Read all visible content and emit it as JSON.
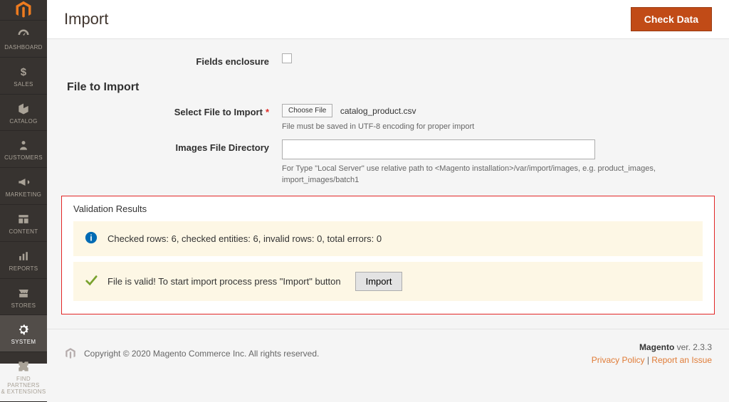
{
  "header": {
    "title": "Import",
    "check_data_label": "Check Data"
  },
  "sidebar": {
    "items": [
      {
        "label": "DASHBOARD"
      },
      {
        "label": "SALES"
      },
      {
        "label": "CATALOG"
      },
      {
        "label": "CUSTOMERS"
      },
      {
        "label": "MARKETING"
      },
      {
        "label": "CONTENT"
      },
      {
        "label": "REPORTS"
      },
      {
        "label": "STORES"
      },
      {
        "label": "SYSTEM"
      },
      {
        "label": "FIND PARTNERS\n& EXTENSIONS"
      }
    ]
  },
  "form": {
    "fields_enclosure_label": "Fields enclosure",
    "section_title": "File to Import",
    "select_file_label": "Select File to Import",
    "choose_file_button": "Choose File",
    "selected_file_name": "catalog_product.csv",
    "select_file_hint": "File must be saved in UTF-8 encoding for proper import",
    "images_dir_label": "Images File Directory",
    "images_dir_value": "",
    "images_dir_hint": "For Type \"Local Server\" use relative path to <Magento installation>/var/import/images, e.g. product_images, import_images/batch1"
  },
  "validation": {
    "title": "Validation Results",
    "info_message": "Checked rows: 6, checked entities: 6, invalid rows: 0, total errors: 0",
    "success_message": "File is valid! To start import process press \"Import\" button",
    "import_button": "Import"
  },
  "footer": {
    "copyright": "Copyright © 2020 Magento Commerce Inc. All rights reserved.",
    "product_name": "Magento",
    "version_prefix": " ver. ",
    "version": "2.3.3",
    "privacy_label": "Privacy Policy",
    "separator": " | ",
    "report_label": "Report an Issue"
  }
}
